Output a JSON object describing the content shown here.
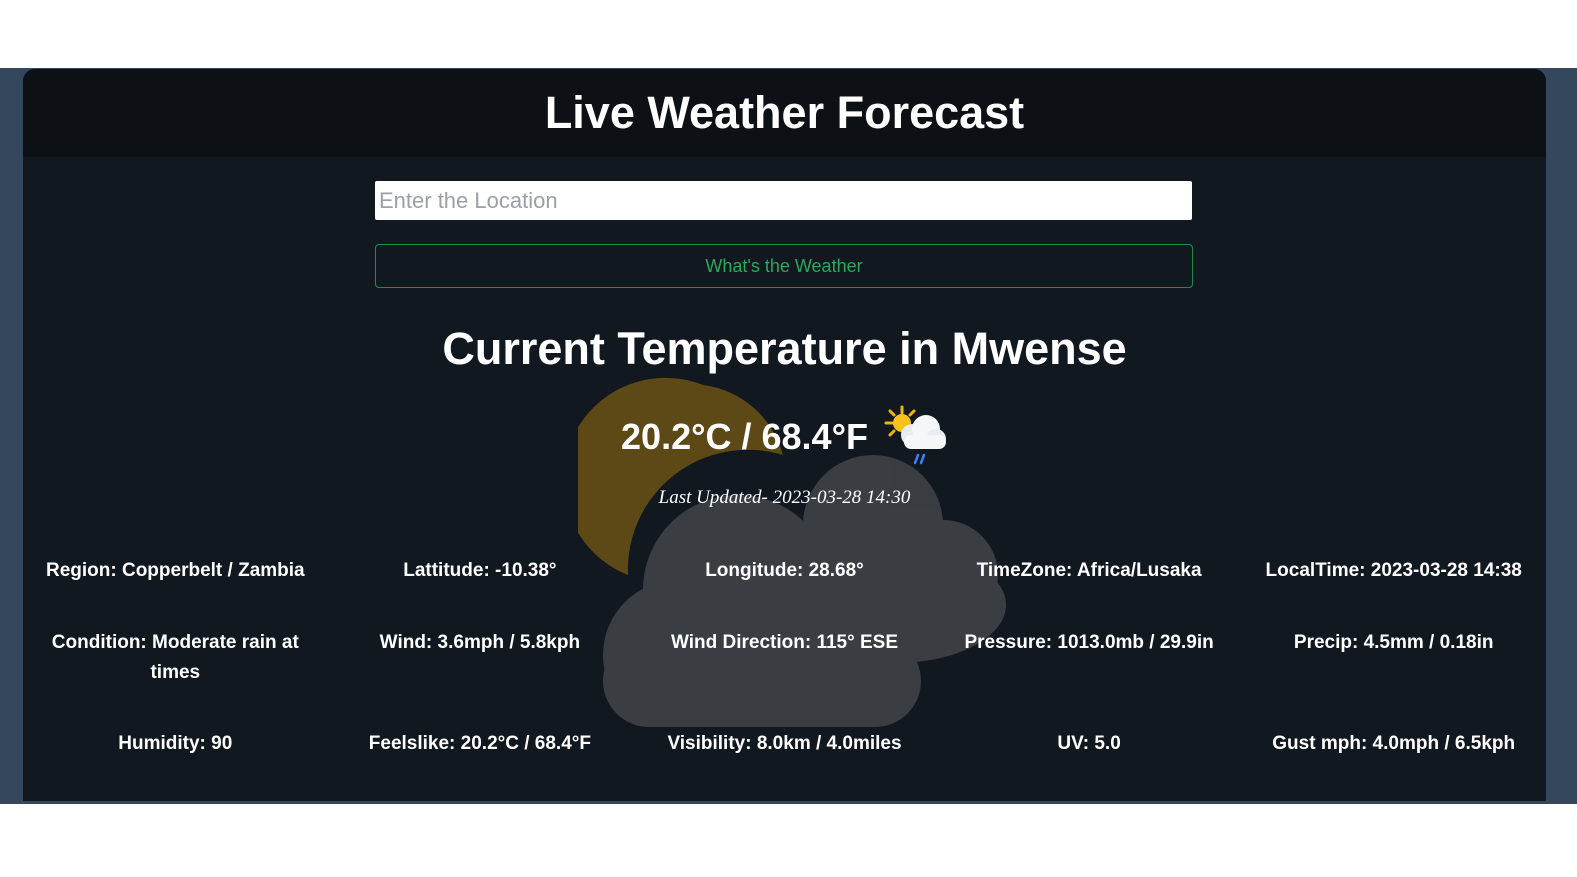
{
  "app": {
    "title": "Live Weather Forecast"
  },
  "search": {
    "placeholder": "Enter the Location",
    "value": "",
    "button_label": "What's the Weather"
  },
  "current": {
    "heading": "Current Temperature in Mwense",
    "temperature": "20.2°C / 68.4°F",
    "condition_icon": "sun-cloud-rain-icon",
    "last_updated": "Last Updated- 2023-03-28 14:30"
  },
  "stats": {
    "region": "Region: Copperbelt / Zambia",
    "latitude": "Lattitude: -10.38°",
    "longitude": "Longitude: 28.68°",
    "timezone": "TimeZone: Africa/Lusaka",
    "localtime": "LocalTime: 2023-03-28 14:38",
    "condition": "Condition: Moderate rain at times",
    "wind": "Wind: 3.6mph / 5.8kph",
    "wind_direction": "Wind Direction: 115° ESE",
    "pressure": "Pressure: 1013.0mb / 29.9in",
    "precip": "Precip: 4.5mm / 0.18in",
    "humidity": "Humidity: 90",
    "feelslike": "Feelslike: 20.2°C / 68.4°F",
    "visibility": "Visibility: 8.0km / 4.0miles",
    "uv": "UV: 5.0",
    "gust": "Gust mph: 4.0mph / 6.5kph"
  },
  "colors": {
    "page_bg": "#ffffff",
    "frame_bg": "#34475d",
    "card_bg": "#121820",
    "header_bg": "#0d1015",
    "button_accent": "#2aa85c",
    "watermark_sun": "#b8860b",
    "watermark_cloud": "#6b6b6b"
  }
}
